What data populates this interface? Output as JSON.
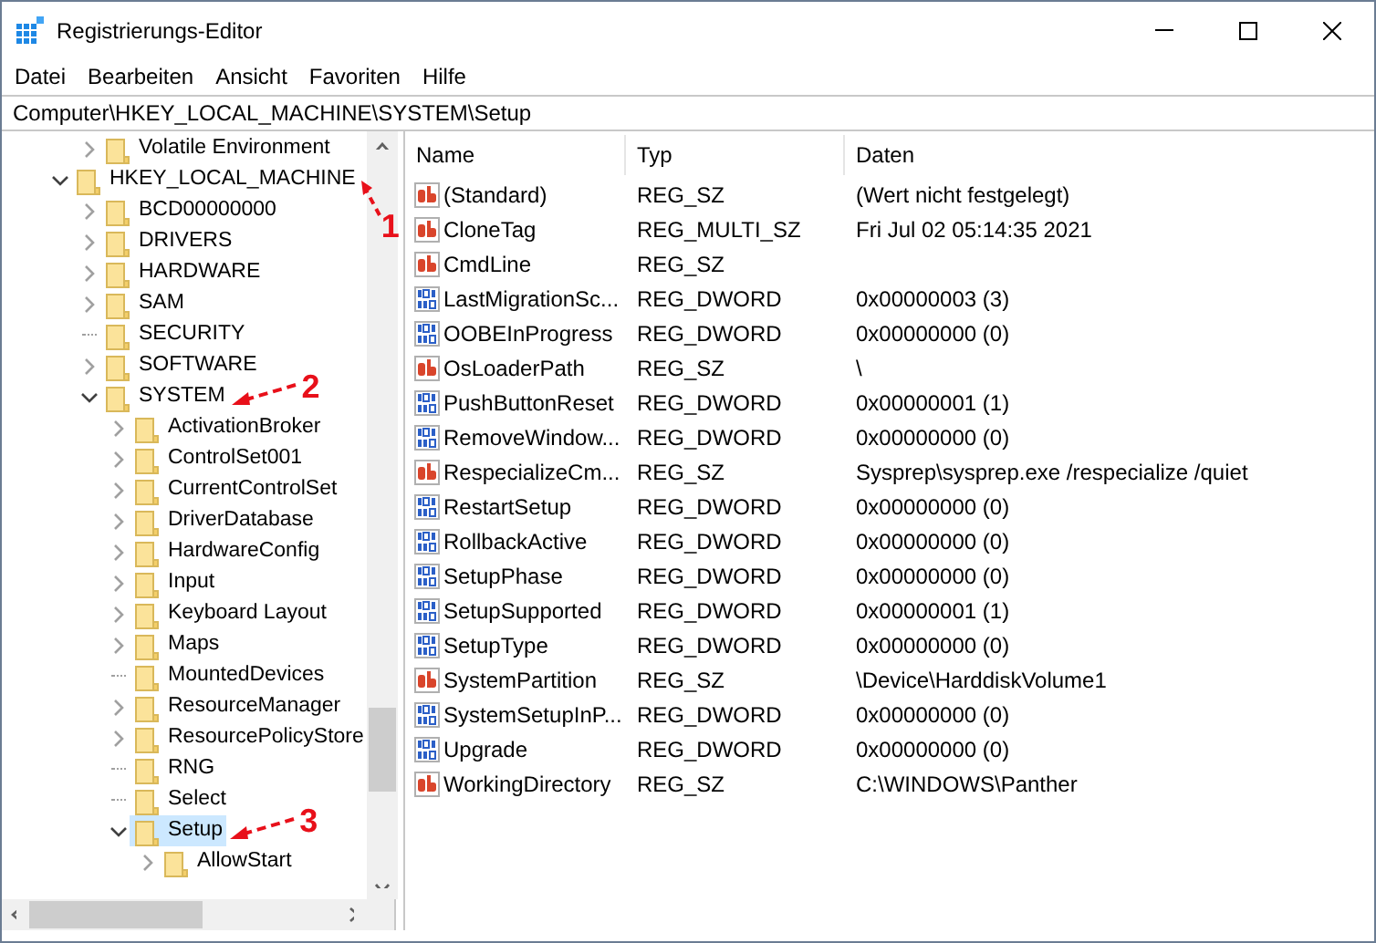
{
  "window": {
    "title": "Registrierungs-Editor"
  },
  "menu": [
    "Datei",
    "Bearbeiten",
    "Ansicht",
    "Favoriten",
    "Hilfe"
  ],
  "address": "Computer\\HKEY_LOCAL_MACHINE\\SYSTEM\\Setup",
  "tree": {
    "scrolled_items": [
      {
        "label": "Volatile Environment",
        "expandable": true,
        "expanded": false,
        "selected": false
      }
    ],
    "roots": [
      {
        "label": "HKEY_LOCAL_MACHINE",
        "expandable": true,
        "expanded": true,
        "selected": false,
        "callout": "1",
        "children": [
          {
            "label": "BCD00000000",
            "expandable": true,
            "expanded": false,
            "selected": false
          },
          {
            "label": "DRIVERS",
            "expandable": true,
            "expanded": false,
            "selected": false
          },
          {
            "label": "HARDWARE",
            "expandable": true,
            "expanded": false,
            "selected": false
          },
          {
            "label": "SAM",
            "expandable": true,
            "expanded": false,
            "selected": false
          },
          {
            "label": "SECURITY",
            "expandable": false,
            "selected": false
          },
          {
            "label": "SOFTWARE",
            "expandable": true,
            "expanded": false,
            "selected": false
          },
          {
            "label": "SYSTEM",
            "expandable": true,
            "expanded": true,
            "selected": false,
            "callout": "2",
            "children": [
              {
                "label": "ActivationBroker",
                "expandable": true,
                "expanded": false,
                "selected": false
              },
              {
                "label": "ControlSet001",
                "expandable": true,
                "expanded": false,
                "selected": false
              },
              {
                "label": "CurrentControlSet",
                "expandable": true,
                "expanded": false,
                "selected": false
              },
              {
                "label": "DriverDatabase",
                "expandable": true,
                "expanded": false,
                "selected": false
              },
              {
                "label": "HardwareConfig",
                "expandable": true,
                "expanded": false,
                "selected": false
              },
              {
                "label": "Input",
                "expandable": true,
                "expanded": false,
                "selected": false
              },
              {
                "label": "Keyboard Layout",
                "expandable": true,
                "expanded": false,
                "selected": false
              },
              {
                "label": "Maps",
                "expandable": true,
                "expanded": false,
                "selected": false
              },
              {
                "label": "MountedDevices",
                "expandable": false,
                "selected": false
              },
              {
                "label": "ResourceManager",
                "expandable": true,
                "expanded": false,
                "selected": false
              },
              {
                "label": "ResourcePolicyStore",
                "expandable": true,
                "expanded": false,
                "selected": false
              },
              {
                "label": "RNG",
                "expandable": false,
                "selected": false
              },
              {
                "label": "Select",
                "expandable": false,
                "selected": false
              },
              {
                "label": "Setup",
                "expandable": true,
                "expanded": true,
                "selected": true,
                "callout": "3",
                "children": [
                  {
                    "label": "AllowStart",
                    "expandable": true,
                    "expanded": false,
                    "selected": false
                  }
                ]
              }
            ]
          }
        ]
      }
    ]
  },
  "values": {
    "columns": [
      "Name",
      "Typ",
      "Daten"
    ],
    "rows": [
      {
        "kind": "string",
        "name": "(Standard)",
        "type": "REG_SZ",
        "data": "(Wert nicht festgelegt)"
      },
      {
        "kind": "string",
        "name": "CloneTag",
        "type": "REG_MULTI_SZ",
        "data": "Fri Jul 02 05:14:35 2021"
      },
      {
        "kind": "string",
        "name": "CmdLine",
        "type": "REG_SZ"
      },
      {
        "kind": "binary",
        "name": "LastMigrationSc...",
        "type": "REG_DWORD",
        "data": "0x00000003 (3)"
      },
      {
        "kind": "binary",
        "name": "OOBEInProgress",
        "type": "REG_DWORD",
        "data": "0x00000000 (0)"
      },
      {
        "kind": "string",
        "name": "OsLoaderPath",
        "type": "REG_SZ",
        "data": "\\"
      },
      {
        "kind": "binary",
        "name": "PushButtonReset",
        "type": "REG_DWORD",
        "data": "0x00000001 (1)"
      },
      {
        "kind": "binary",
        "name": "RemoveWindow...",
        "type": "REG_DWORD",
        "data": "0x00000000 (0)"
      },
      {
        "kind": "string",
        "name": "RespecializeCm...",
        "type": "REG_SZ",
        "data": "Sysprep\\sysprep.exe /respecialize /quiet"
      },
      {
        "kind": "binary",
        "name": "RestartSetup",
        "type": "REG_DWORD",
        "data": "0x00000000 (0)"
      },
      {
        "kind": "binary",
        "name": "RollbackActive",
        "type": "REG_DWORD",
        "data": "0x00000000 (0)"
      },
      {
        "kind": "binary",
        "name": "SetupPhase",
        "type": "REG_DWORD",
        "data": "0x00000000 (0)"
      },
      {
        "kind": "binary",
        "name": "SetupSupported",
        "type": "REG_DWORD",
        "data": "0x00000001 (1)"
      },
      {
        "kind": "binary",
        "name": "SetupType",
        "type": "REG_DWORD",
        "data": "0x00000000 (0)"
      },
      {
        "kind": "string",
        "name": "SystemPartition",
        "type": "REG_SZ",
        "data": "\\Device\\HarddiskVolume1"
      },
      {
        "kind": "binary",
        "name": "SystemSetupInP...",
        "type": "REG_DWORD",
        "data": "0x00000000 (0)"
      },
      {
        "kind": "binary",
        "name": "Upgrade",
        "type": "REG_DWORD",
        "data": "0x00000000 (0)"
      },
      {
        "kind": "string",
        "name": "WorkingDirectory",
        "type": "REG_SZ",
        "data": "C:\\WINDOWS\\Panther"
      }
    ]
  }
}
